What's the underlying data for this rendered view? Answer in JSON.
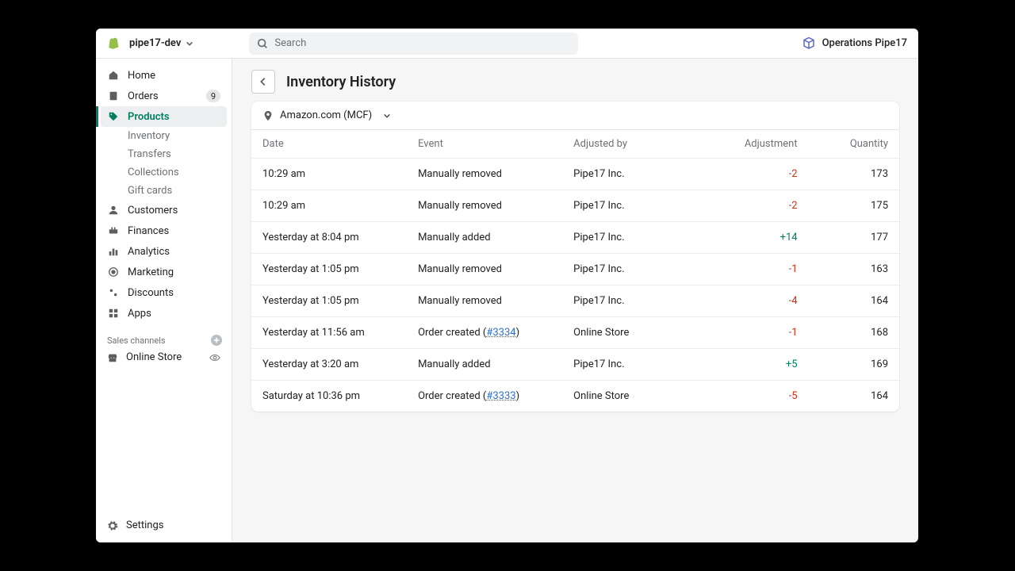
{
  "header": {
    "store_name": "pipe17-dev",
    "search_placeholder": "Search",
    "account_label": "Operations Pipe17"
  },
  "sidebar": {
    "items": [
      {
        "key": "home",
        "label": "Home"
      },
      {
        "key": "orders",
        "label": "Orders",
        "badge": "9"
      },
      {
        "key": "products",
        "label": "Products",
        "active": true,
        "sub": [
          {
            "label": "Inventory"
          },
          {
            "label": "Transfers"
          },
          {
            "label": "Collections"
          },
          {
            "label": "Gift cards"
          }
        ]
      },
      {
        "key": "customers",
        "label": "Customers"
      },
      {
        "key": "finances",
        "label": "Finances"
      },
      {
        "key": "analytics",
        "label": "Analytics"
      },
      {
        "key": "marketing",
        "label": "Marketing"
      },
      {
        "key": "discounts",
        "label": "Discounts"
      },
      {
        "key": "apps",
        "label": "Apps"
      }
    ],
    "sales_channels_label": "Sales channels",
    "channels": [
      {
        "label": "Online Store"
      }
    ],
    "settings_label": "Settings"
  },
  "page": {
    "title": "Inventory History",
    "location": "Amazon.com (MCF)",
    "columns": {
      "date": "Date",
      "event": "Event",
      "adjusted_by": "Adjusted by",
      "adjustment": "Adjustment",
      "quantity": "Quantity"
    },
    "rows": [
      {
        "date": "10:29 am",
        "event_text": "Manually removed",
        "adjusted_by": "Pipe17 Inc.",
        "adjustment": "-2",
        "adj_sign": "neg",
        "quantity": "173"
      },
      {
        "date": "10:29 am",
        "event_text": "Manually removed",
        "adjusted_by": "Pipe17 Inc.",
        "adjustment": "-2",
        "adj_sign": "neg",
        "quantity": "175"
      },
      {
        "date": "Yesterday at 8:04 pm",
        "event_text": "Manually added",
        "adjusted_by": "Pipe17 Inc.",
        "adjustment": "+14",
        "adj_sign": "pos",
        "quantity": "177"
      },
      {
        "date": "Yesterday at 1:05 pm",
        "event_text": "Manually removed",
        "adjusted_by": "Pipe17 Inc.",
        "adjustment": "-1",
        "adj_sign": "neg",
        "quantity": "163"
      },
      {
        "date": "Yesterday at 1:05 pm",
        "event_text": "Manually removed",
        "adjusted_by": "Pipe17 Inc.",
        "adjustment": "-4",
        "adj_sign": "neg",
        "quantity": "164"
      },
      {
        "date": "Yesterday at 11:56 am",
        "event_prefix": "Order created (",
        "order_link": "#3334",
        "event_suffix": ")",
        "adjusted_by": "Online Store",
        "adjustment": "-1",
        "adj_sign": "neg",
        "quantity": "168"
      },
      {
        "date": "Yesterday at 3:20 am",
        "event_text": "Manually added",
        "adjusted_by": "Pipe17 Inc.",
        "adjustment": "+5",
        "adj_sign": "pos",
        "quantity": "169"
      },
      {
        "date": "Saturday at 10:36 pm",
        "event_prefix": "Order created (",
        "order_link": "#3333",
        "event_suffix": ")",
        "adjusted_by": "Online Store",
        "adjustment": "-5",
        "adj_sign": "neg",
        "quantity": "164"
      }
    ]
  }
}
